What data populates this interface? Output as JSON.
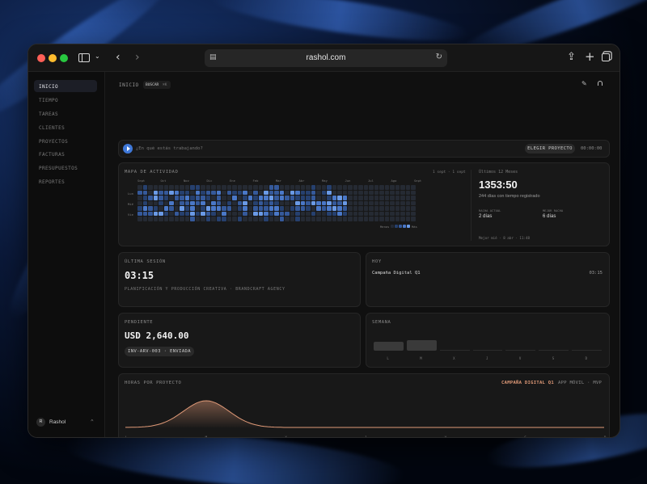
{
  "browser": {
    "url": "rashol.com"
  },
  "sidebar": {
    "items": [
      {
        "label": "INICIO",
        "active": true
      },
      {
        "label": "TIEMPO",
        "active": false
      },
      {
        "label": "TAREAS",
        "active": false
      },
      {
        "label": "CLIENTES",
        "active": false
      },
      {
        "label": "PROYECTOS",
        "active": false
      },
      {
        "label": "FACTURAS",
        "active": false
      },
      {
        "label": "PRESUPUESTOS",
        "active": false
      },
      {
        "label": "REPORTES",
        "active": false
      }
    ],
    "user": {
      "initial": "R",
      "name": "Rashol"
    }
  },
  "header": {
    "title": "INICIO",
    "search_label": "BUSCAR",
    "search_shortcut": "⌘K"
  },
  "timer": {
    "placeholder": "¿En qué estás trabajando?",
    "project_button": "ELEGIR PROYECTO",
    "elapsed": "00:00:00"
  },
  "activity": {
    "title": "MAPA DE ACTIVIDAD",
    "range": "1 sept - 1 sept",
    "months": [
      "Sept",
      "Oct",
      "Nov",
      "Dic",
      "Ene",
      "Feb",
      "Mar",
      "Abr",
      "May",
      "Jun",
      "Jul",
      "Ago",
      "Sept"
    ],
    "days": [
      "Lun",
      "Mié",
      "Vie"
    ],
    "legend_less": "Menos",
    "legend_more": "Más",
    "summary_title": "Últimos 12 Meses",
    "total": "1353:50",
    "total_caption": "244 días con tiempo registrado",
    "streak_current_label": "RACHA ACTUAL",
    "streak_current": "2 días",
    "streak_best_label": "MEJOR RACHA",
    "streak_best": "6 días",
    "footer": "Mejor mié · 8 abr · 11:48",
    "colors": {
      "empty": "#252a33",
      "l1": "#26406e",
      "l2": "#35599a",
      "l3": "#4a78c8",
      "l4": "#6a9ae6"
    }
  },
  "last_session": {
    "label": "ÚLTIMA SESIÓN",
    "duration": "03:15",
    "description": "PLANIFICACIÓN Y PRODUCCIÓN CREATIVA · BRANDCRAFT AGENCY"
  },
  "today": {
    "label": "HOY",
    "project": "Campaña Digital Q1",
    "duration": "03:15"
  },
  "pending": {
    "label": "PENDIENTE",
    "amount": "USD 2,640.00",
    "invoice": "INV-ARV-003 · ENVIADA"
  },
  "week": {
    "label": "SEMANA",
    "days": [
      "L",
      "M",
      "X",
      "J",
      "V",
      "S",
      "D"
    ],
    "hours": [
      2.2,
      2.6,
      0,
      0,
      0,
      0,
      0
    ]
  },
  "hours_by_project": {
    "label": "HORAS POR PROYECTO",
    "legend_active": "CAMPAÑA DIGITAL Q1",
    "legend_other": "APP MÓVIL · MVP",
    "accent": "#e09a78",
    "days": [
      "L",
      "M",
      "X",
      "J",
      "V",
      "S",
      "D"
    ]
  }
}
